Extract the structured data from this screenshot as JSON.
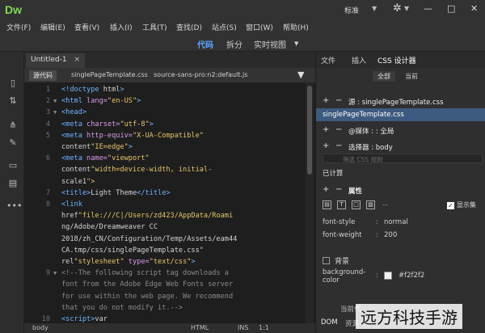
{
  "app": {
    "logo": "Dw",
    "workspace": "标准",
    "window_controls": [
      "—",
      "□",
      "✕"
    ]
  },
  "menu": [
    "文件(F)",
    "编辑(E)",
    "查看(V)",
    "插入(I)",
    "工具(T)",
    "查找(D)",
    "站点(S)",
    "窗口(W)",
    "帮助(H)"
  ],
  "views": {
    "code": "代码",
    "split": "拆分",
    "live": "实时视图",
    "live_caret": "▼"
  },
  "document": {
    "tab_title": "Untitled-1",
    "tab_close": "×",
    "source_button": "源代码",
    "related_files": [
      "singlePageTemplate.css",
      "source-sans-pro:n2:default.js"
    ]
  },
  "code_lines": [
    {
      "n": "1",
      "fold": "",
      "html": "<!doctype html>"
    },
    {
      "n": "2",
      "fold": "▼",
      "html": "<html lang=\"en-US\">"
    },
    {
      "n": "3",
      "fold": "▼",
      "html": "<head>"
    },
    {
      "n": "4",
      "fold": "",
      "html": "<meta charset=\"utf-8\">"
    },
    {
      "n": "5",
      "fold": "",
      "html": "<meta http-equiv=\"X-UA-Compatible\""
    },
    {
      "n": "",
      "fold": "",
      "html": "content=\"IE=edge\">"
    },
    {
      "n": "6",
      "fold": "",
      "html": "<meta name=\"viewport\""
    },
    {
      "n": "",
      "fold": "",
      "html": "content=\"width=device-width, initial-"
    },
    {
      "n": "",
      "fold": "",
      "html": "scale=1\">"
    },
    {
      "n": "7",
      "fold": "",
      "html": "<title>Light Theme</title>"
    },
    {
      "n": "8",
      "fold": "",
      "html": "<link"
    },
    {
      "n": "",
      "fold": "",
      "html": "href=\"file:///C|/Users/zd423/AppData/Roami"
    },
    {
      "n": "",
      "fold": "",
      "html": "ng/Adobe/Dreamweaver CC"
    },
    {
      "n": "",
      "fold": "",
      "html": "2018/zh_CN/Configuration/Temp/Assets/eam44"
    },
    {
      "n": "",
      "fold": "",
      "html": "CA.tmp/css/singlePageTemplate.css\""
    },
    {
      "n": "",
      "fold": "",
      "html": "rel=\"stylesheet\" type=\"text/css\">"
    },
    {
      "n": "9",
      "fold": "▼",
      "html": "<!--The following script tag downloads a"
    },
    {
      "n": "",
      "fold": "",
      "html": "font from the Adobe Edge Web Fonts server"
    },
    {
      "n": "",
      "fold": "",
      "html": "for use within the web page. We recommend"
    },
    {
      "n": "",
      "fold": "",
      "html": "that you do not modify it.-->"
    },
    {
      "n": "10",
      "fold": "",
      "html": "<script>var"
    }
  ],
  "status": {
    "element": "body",
    "lang": "HTML",
    "mode": "INS",
    "position": "1:1"
  },
  "panel": {
    "tabs": [
      "文件",
      "插入",
      "CSS 设计器"
    ],
    "filter_all": "全部",
    "filter_current": "当前",
    "sources_label": "源 : singlePageTemplate.css",
    "selected_source": "singlePageTemplate.css",
    "media_label": "@媒体 : : 全局",
    "selector_label": "选择器 : body",
    "filter_placeholder": "筛选 CSS 规则",
    "computed_label": "已计算",
    "properties_label": "属性",
    "show_set": "显示集",
    "props": [
      {
        "name": "font-style",
        "value": "normal"
      },
      {
        "name": "font-weight",
        "value": "200"
      }
    ],
    "background_label": "背景",
    "bg_color_name_1": "background-",
    "bg_color_name_2": "color",
    "bg_color_value": "#f2f2f2",
    "bottom_labels": [
      "当前代",
      "DOM",
      "资源"
    ]
  },
  "watermark": "远方科技手游"
}
